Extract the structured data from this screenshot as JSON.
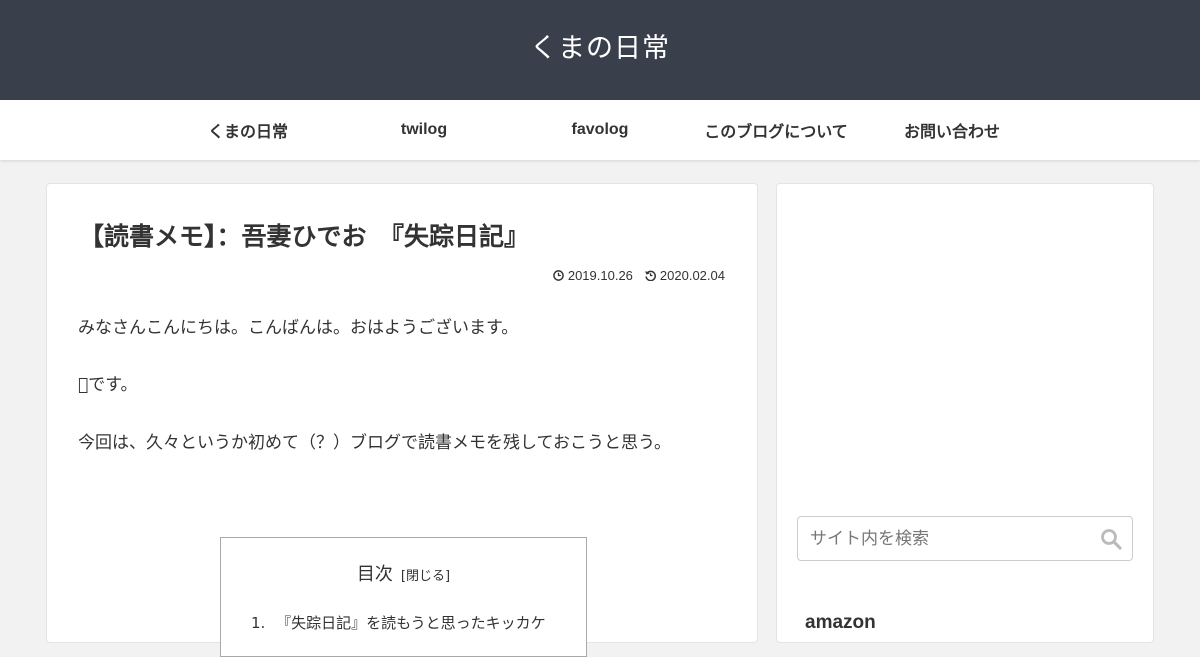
{
  "header": {
    "site_title": "くまの日常",
    "bg_color": "#3a3f4c"
  },
  "nav": {
    "items": [
      {
        "label": "くまの日常"
      },
      {
        "label": "twilog"
      },
      {
        "label": "favolog"
      },
      {
        "label": "このブログについて"
      },
      {
        "label": "お問い合わせ"
      }
    ]
  },
  "article": {
    "title": "【読書メモ】：吾妻ひでお　『失踪日記』",
    "published_date": "2019.10.26",
    "updated_date": "2020.02.04",
    "paragraphs": [
      "みなさんこんにちは。こんばんは。おはようございます。",
      "󱁗です。",
      "今回は、久々というか初めて（？）ブログで読書メモを残しておこうと思う。"
    ],
    "toc": {
      "title": "目次",
      "toggle_label": "[閉じる]",
      "items": [
        {
          "number": "1.",
          "label": "『失踪日記』を読もうと思ったキッカケ"
        }
      ]
    }
  },
  "sidebar": {
    "search": {
      "placeholder": "サイト内を検索",
      "icon": "search-icon"
    },
    "widget_title": "amazon"
  }
}
